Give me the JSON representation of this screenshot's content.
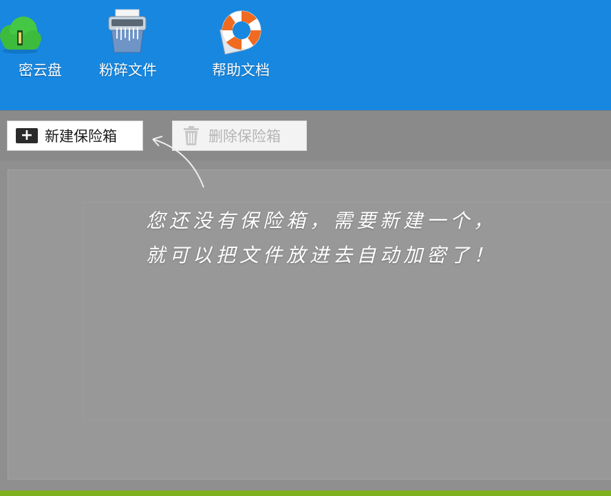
{
  "toolbar": {
    "items": [
      {
        "label": "密云盘",
        "icon": "cloud-lock-icon"
      },
      {
        "label": "粉碎文件",
        "icon": "shredder-icon"
      },
      {
        "label": "帮助文档",
        "icon": "lifebuoy-icon"
      }
    ]
  },
  "actions": {
    "new_vault": "新建保险箱",
    "delete_vault": "删除保险箱"
  },
  "hint": {
    "line1": "您还没有保险箱，需要新建一个，",
    "line2": "就可以把文件放进去自动加密了！"
  },
  "colors": {
    "toolbar_bg": "#1787e0",
    "content_bg": "#989898",
    "bottom_strip": "#7fb01e"
  }
}
